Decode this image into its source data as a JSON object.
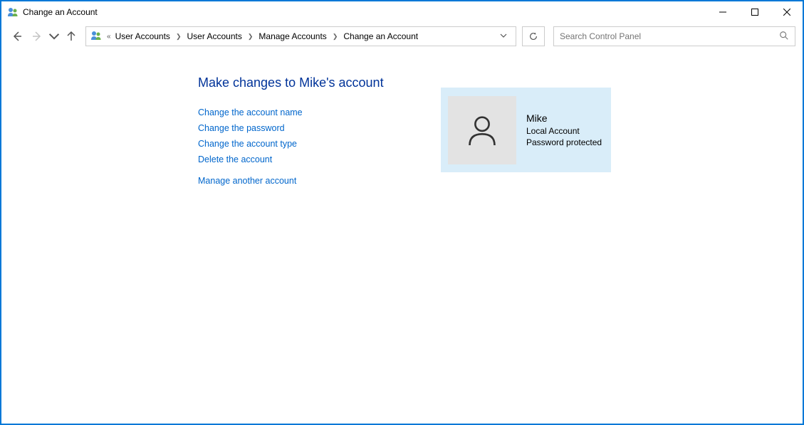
{
  "window": {
    "title": "Change an Account"
  },
  "breadcrumb": {
    "items": [
      "User Accounts",
      "User Accounts",
      "Manage Accounts",
      "Change an Account"
    ]
  },
  "search": {
    "placeholder": "Search Control Panel"
  },
  "page": {
    "heading": "Make changes to Mike's account",
    "links": {
      "change_name": "Change the account name",
      "change_password": "Change the password",
      "change_type": "Change the account type",
      "delete": "Delete the account",
      "manage_another": "Manage another account"
    }
  },
  "account": {
    "name": "Mike",
    "type": "Local Account",
    "status": "Password protected"
  }
}
